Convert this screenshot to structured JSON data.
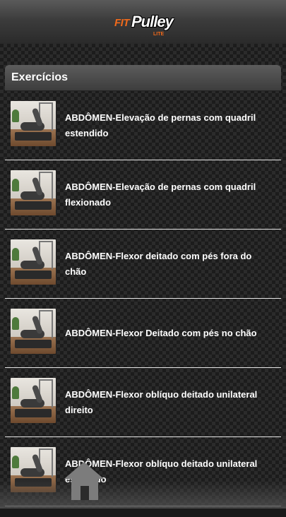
{
  "app": {
    "logo_fit": "FIT",
    "logo_pulley": "Pulley",
    "logo_lite": "LITE"
  },
  "panel": {
    "title": "Exercícios"
  },
  "exercises": [
    {
      "title": "ABDÔMEN-Elevação de pernas com quadril estendido"
    },
    {
      "title": "ABDÔMEN-Elevação de pernas com quadril flexionado"
    },
    {
      "title": "ABDÔMEN-Flexor deitado com pés fora do chão"
    },
    {
      "title": "ABDÔMEN-Flexor Deitado com pés no chão"
    },
    {
      "title": "ABDÔMEN-Flexor oblíquo deitado unilateral direito"
    },
    {
      "title": "ABDÔMEN-Flexor oblíquo deitado unilateral esquerdo"
    }
  ],
  "nav": {
    "home_icon": "home-icon"
  }
}
